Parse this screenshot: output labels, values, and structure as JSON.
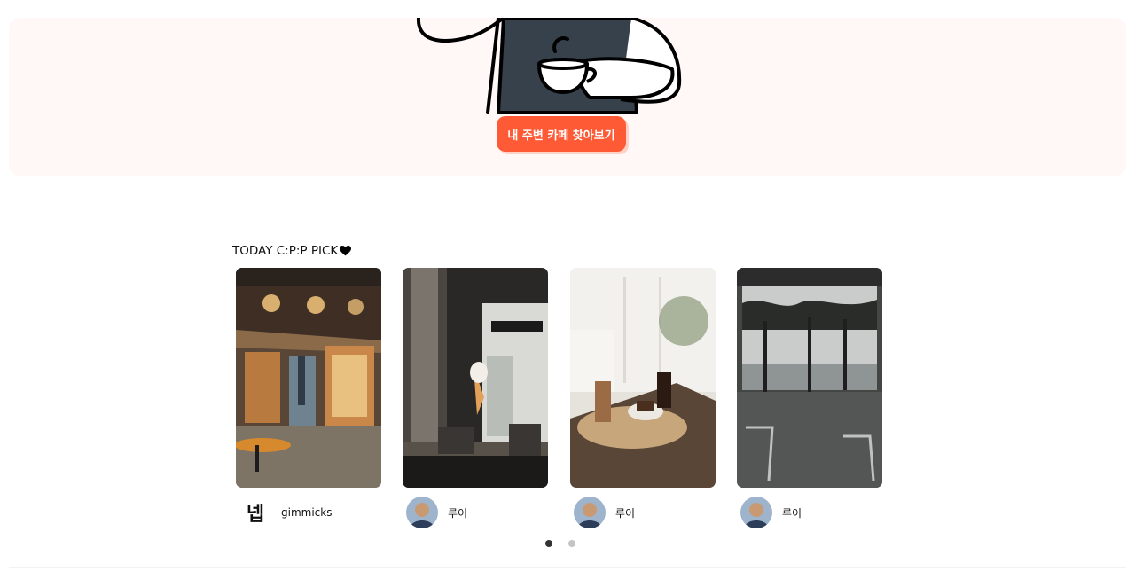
{
  "hero": {
    "cta_label": "내 주변 카페 찾아보기"
  },
  "pick_section": {
    "title": "TODAY C:P:P PICK",
    "heart_icon": "heart-icon",
    "cards": [
      {
        "author": "gimmicks",
        "avatar_text": "넵",
        "photo": "cafe-interior-warm-lights"
      },
      {
        "author": "루이",
        "avatar_text": "",
        "photo": "cafe-dark-interior-ice-cream-sign"
      },
      {
        "author": "루이",
        "avatar_text": "",
        "photo": "latte-and-cake-by-window"
      },
      {
        "author": "루이",
        "avatar_text": "",
        "photo": "seaside-terrace-pine-trees"
      }
    ]
  },
  "pagination": {
    "pages": 2,
    "active": 1
  },
  "colors": {
    "accent": "#ff5a36",
    "hero_bg": "#fff8f6",
    "dot_active": "#333333",
    "dot_inactive": "#c4c4c4"
  }
}
